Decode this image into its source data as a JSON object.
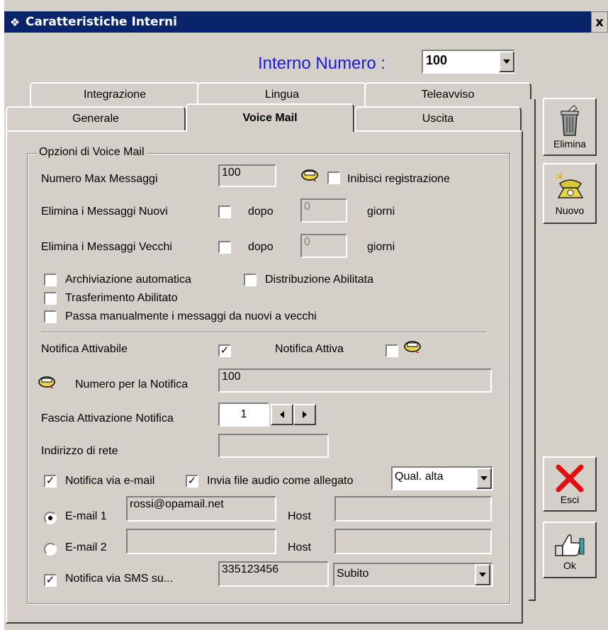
{
  "window": {
    "title": "Caratteristiche Interni",
    "app_icon": "diamond-icon",
    "close": "x"
  },
  "header": {
    "label": "Interno Numero :",
    "value": "100",
    "label_color": "#1a1adb"
  },
  "tabs": {
    "row_back": [
      "Integrazione",
      "Lingua",
      "Teleavviso"
    ],
    "row_front": [
      "Generale",
      "Voice Mail",
      "Uscita"
    ],
    "active": "Voice Mail"
  },
  "group": {
    "title": "Opzioni di Voice Mail"
  },
  "form": {
    "max_msg_label": "Numero Max Messaggi",
    "max_msg_value": "100",
    "inibisci_label": "Inibisci registrazione",
    "inibisci_checked": false,
    "del_new_label": "Elimina i Messaggi Nuovi",
    "del_new_dopo": "dopo",
    "del_new_value": "0",
    "del_new_giorni": "giorni",
    "del_old_label": "Elimina i Messaggi Vecchi",
    "del_old_dopo": "dopo",
    "del_old_value": "0",
    "del_old_giorni": "giorni",
    "archiv_label": "Archiviazione automatica",
    "distrib_label": "Distribuzione Abilitata",
    "trasf_label": "Trasferimento Abilitato",
    "passa_label": "Passa manualmente i messaggi da nuovi a vecchi",
    "notif_attivabile_label": "Notifica Attivabile",
    "notif_attivabile_checked": true,
    "notif_attiva_label": "Notifica Attiva",
    "notif_attiva_checked": false,
    "numero_notif_label": "Numero per la Notifica",
    "numero_notif_value": "100",
    "fascia_label": "Fascia Attivazione Notifica",
    "fascia_value": "1",
    "indirizzo_label": "Indirizzo di rete",
    "indirizzo_value": "",
    "notif_email_label": "Notifica via e-mail",
    "notif_email_checked": true,
    "invia_audio_label": "Invia file audio come allegato",
    "invia_audio_checked": true,
    "qualita_value": "Qual. alta",
    "email1_label": "E-mail 1",
    "email1_value": "rossi@opamail.net",
    "email1_selected": true,
    "host_label": "Host",
    "host1_value": "",
    "email2_label": "E-mail 2",
    "email2_value": "",
    "host2_label": "Host",
    "host2_value": "",
    "sms_label": "Notifica via SMS su...",
    "sms_checked": true,
    "sms_value": "335123456",
    "sms_timing": "Subito"
  },
  "sidebar": {
    "elimina": "Elimina",
    "nuovo": "Nuovo",
    "esci": "Esci",
    "ok": "Ok"
  },
  "icons": {
    "elimina": "trash-can-icon",
    "nuovo": "telephone-icon",
    "esci": "red-x-icon",
    "ok": "thumbs-up-icon",
    "phone_small": "phone-handset-icon"
  }
}
